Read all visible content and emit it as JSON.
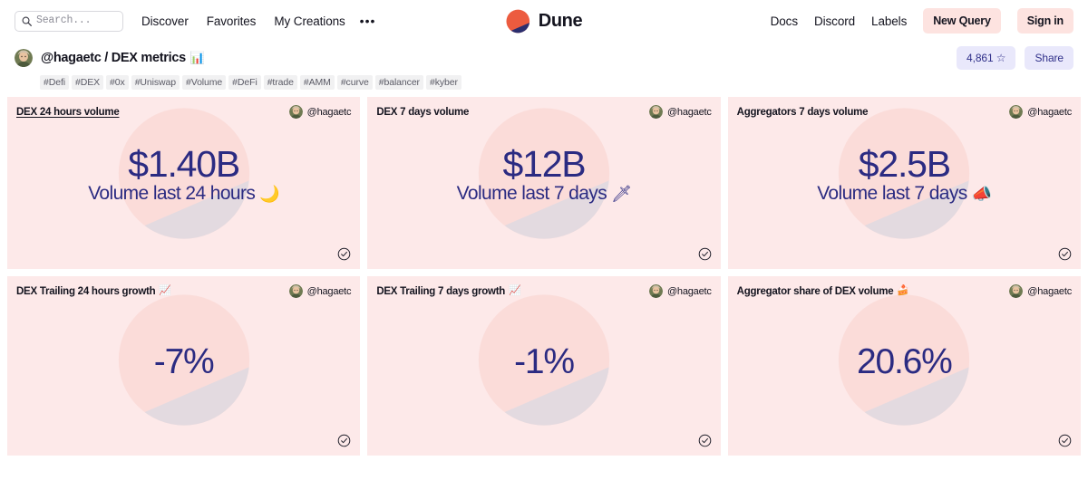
{
  "nav": {
    "search": {
      "placeholder": "Search...",
      "icon": "search-icon"
    },
    "links": [
      {
        "label": "Discover"
      },
      {
        "label": "Favorites"
      },
      {
        "label": "My Creations"
      }
    ],
    "more_label": "•••",
    "brand": {
      "name": "Dune",
      "logo_icon": "dune-logo-icon"
    },
    "right_links": [
      {
        "label": "Docs"
      },
      {
        "label": "Discord"
      },
      {
        "label": "Labels"
      }
    ],
    "new_query_label": "New Query",
    "sign_in_label": "Sign in"
  },
  "profile": {
    "avatar_icon": "user-avatar",
    "title": "@hagaetc / DEX metrics",
    "title_emoji": "📊",
    "stars_label": "4,861 ☆",
    "share_label": "Share"
  },
  "tags": [
    "#Defi",
    "#DEX",
    "#0x",
    "#Uniswap",
    "#Volume",
    "#DeFi",
    "#trade",
    "#AMM",
    "#curve",
    "#balancer",
    "#kyber"
  ],
  "colors": {
    "card_bg": "#fde9e9",
    "counter_text": "#2b2b82",
    "accent_pink": "#fde3e0",
    "accent_lavender": "#e9e8fb",
    "lavender_text": "#30308a",
    "logo_orange": "#ec5b3f",
    "logo_navy": "#2b2e6e",
    "tag_bg": "#f1f1f2"
  },
  "cards": [
    {
      "title": "DEX 24 hours volume",
      "title_emoji": "",
      "title_underlined": true,
      "author": "@hagaetc",
      "value": "$1.40B",
      "label": "Volume last 24 hours",
      "label_emoji": "🌙",
      "check_icon": "check-circle-icon"
    },
    {
      "title": "DEX 7 days volume",
      "title_emoji": "",
      "title_underlined": false,
      "author": "@hagaetc",
      "value": "$12B",
      "label": "Volume last 7 days",
      "label_emoji": "🗡",
      "check_icon": "check-circle-icon"
    },
    {
      "title": "Aggregators 7 days volume",
      "title_emoji": "",
      "title_underlined": false,
      "author": "@hagaetc",
      "value": "$2.5B",
      "label": "Volume last 7 days",
      "label_emoji": "📣",
      "check_icon": "check-circle-icon"
    },
    {
      "title": "DEX Trailing 24 hours growth",
      "title_emoji": "📈",
      "title_underlined": false,
      "author": "@hagaetc",
      "value": "-7%",
      "label": "",
      "label_emoji": "",
      "check_icon": "check-circle-icon"
    },
    {
      "title": "DEX Trailing 7 days growth",
      "title_emoji": "📈",
      "title_underlined": false,
      "author": "@hagaetc",
      "value": "-1%",
      "label": "",
      "label_emoji": "",
      "check_icon": "check-circle-icon"
    },
    {
      "title": "Aggregator share of DEX volume",
      "title_emoji": "🍰",
      "title_underlined": false,
      "author": "@hagaetc",
      "value": "20.6%",
      "label": "",
      "label_emoji": "",
      "check_icon": "check-circle-icon"
    }
  ]
}
